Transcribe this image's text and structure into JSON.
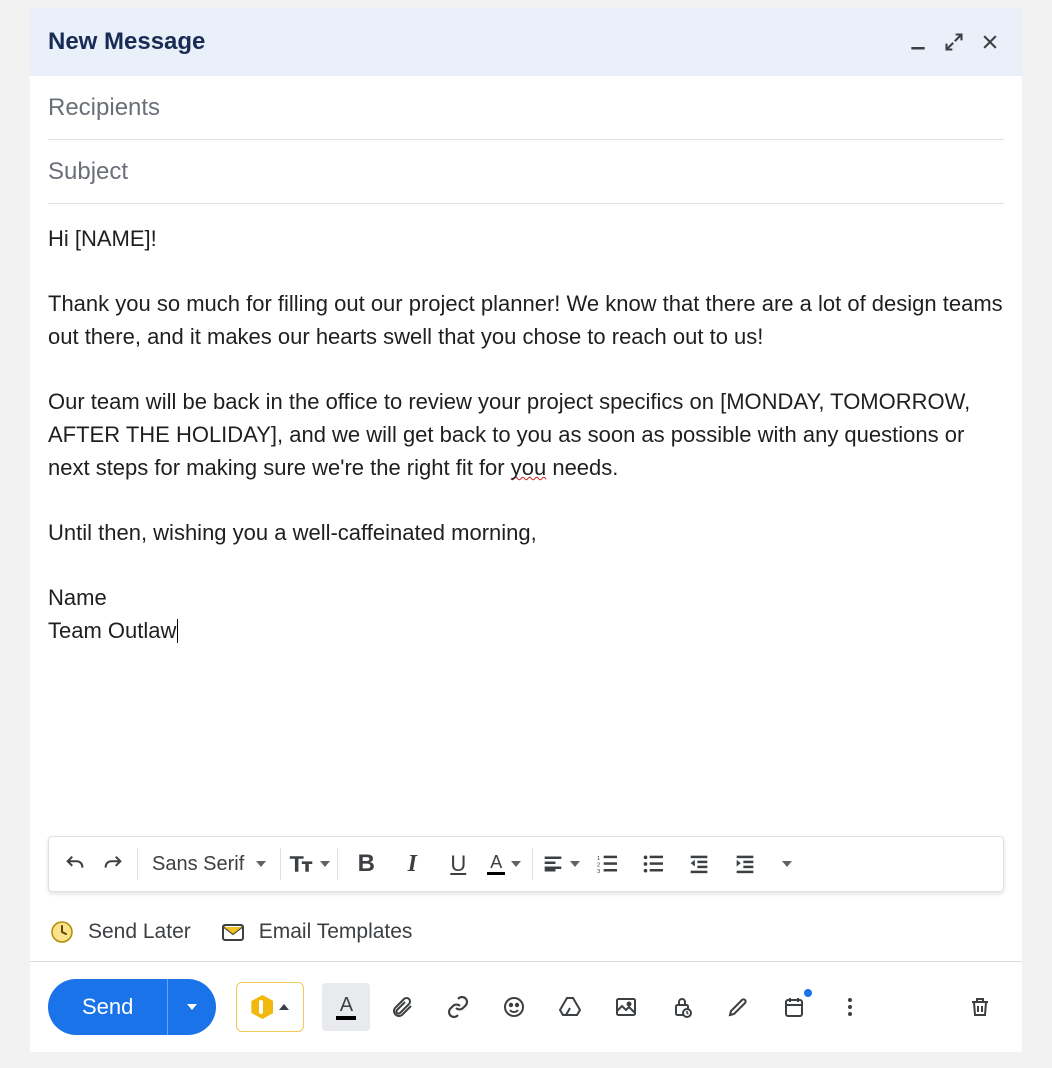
{
  "header": {
    "title": "New Message"
  },
  "fields": {
    "recipients_placeholder": "Recipients",
    "subject_placeholder": "Subject"
  },
  "body": {
    "greeting": "Hi [NAME]!",
    "p1": "Thank you so much for filling out our project planner! We know that there are a lot of design teams out there, and it makes our hearts swell that you chose to reach out to us!",
    "p2a": "Our team will be back in the office to review your project specifics on [MONDAY, TOMORROW, AFTER THE HOLIDAY], and we will get back to you as soon as possible with any questions or next steps for making sure we're the right fit for ",
    "p2_wavy": "you",
    "p2b": " needs.",
    "p3": "Until then, wishing you a well-caffeinated morning,",
    "sig1": "Name",
    "sig2": "Team Outlaw"
  },
  "format_toolbar": {
    "font_name": "Sans Serif"
  },
  "extensions": {
    "send_later": "Send Later",
    "email_templates": "Email Templates"
  },
  "actions": {
    "send_label": "Send"
  }
}
